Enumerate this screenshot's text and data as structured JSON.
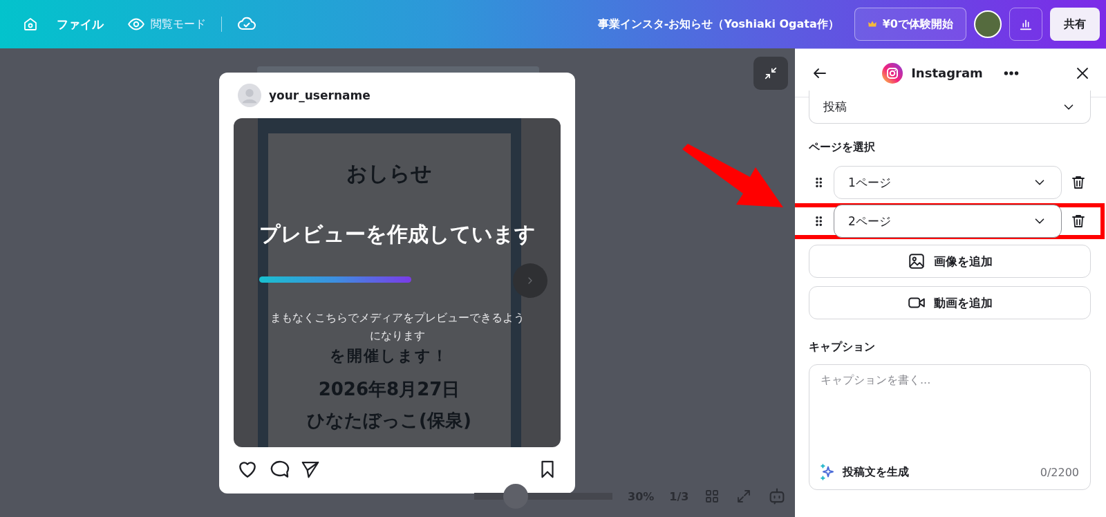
{
  "topbar": {
    "file_menu": "ファイル",
    "view_mode": "閲覧モード",
    "doc_title": "事業インスタ-お知らせ（Yoshiaki Ogata作）",
    "trial_button": "¥0で体験開始",
    "share_button": "共有"
  },
  "preview": {
    "username": "your_username",
    "design_texts": [
      "おしらせ",
      "を開催します！",
      "2026年8月27日",
      "ひなたぼっこ(保泉)"
    ],
    "overlay_title": "プレビューを作成しています",
    "progress": {
      "level": 0.55
    },
    "overlay_message": "まもなくこちらでメディアをプレビューできるようになります"
  },
  "bottom_bar": {
    "zoom_slider": {
      "level": 0.3
    },
    "zoom_level": "30%",
    "page_counter": "1/3"
  },
  "panel": {
    "title": "Instagram",
    "post_type": "投稿",
    "pages_label": "ページを選択",
    "pages": [
      {
        "value": "1ページ",
        "highlighted": false
      },
      {
        "value": "2ページ",
        "highlighted": true
      }
    ],
    "add_buttons": [
      {
        "kind": "image",
        "label": "画像を追加"
      },
      {
        "kind": "video",
        "label": "動画を追加"
      }
    ],
    "caption_label": "キャプション",
    "caption": {
      "placeholder": "キャプションを書く...",
      "generate_label": "投稿文を生成",
      "counter": "0/2200"
    }
  }
}
